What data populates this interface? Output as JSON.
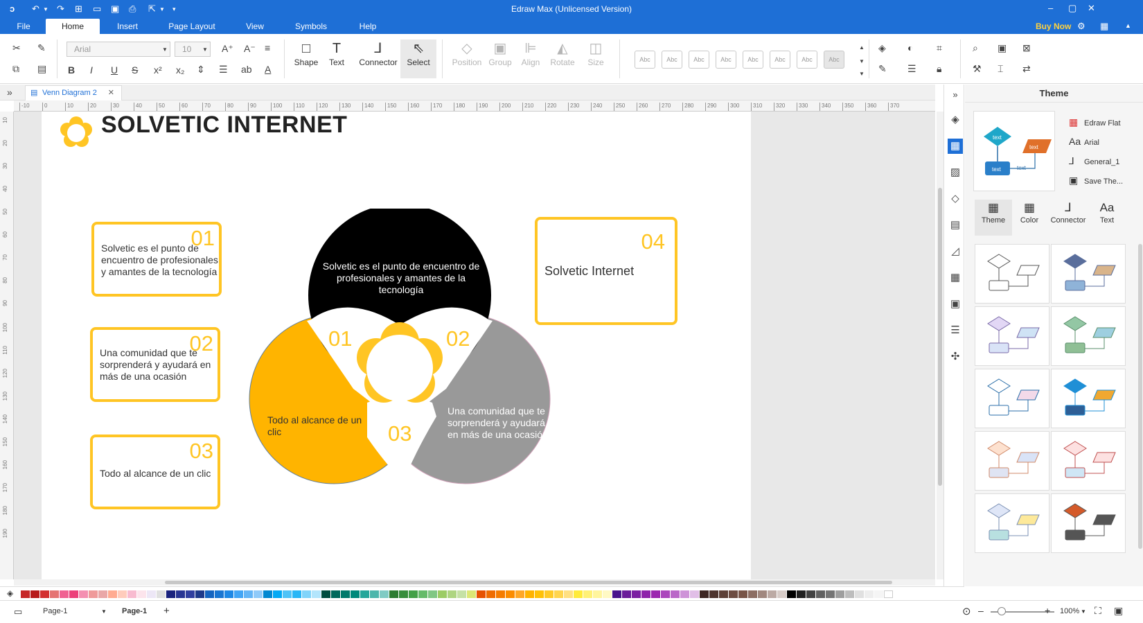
{
  "app": {
    "title": "Edraw Max (Unlicensed Version)",
    "buy_now": "Buy Now"
  },
  "menu": {
    "tabs": [
      {
        "label": "File"
      },
      {
        "label": "Home"
      },
      {
        "label": "Insert"
      },
      {
        "label": "Page Layout"
      },
      {
        "label": "View"
      },
      {
        "label": "Symbols"
      },
      {
        "label": "Help"
      }
    ],
    "active": "Home"
  },
  "ribbon": {
    "font_name": "Arial",
    "font_size": "10",
    "tools": {
      "shape": "Shape",
      "text": "Text",
      "connector": "Connector",
      "select": "Select"
    },
    "arrange": {
      "position": "Position",
      "group": "Group",
      "align": "Align",
      "rotate": "Rotate",
      "size": "Size"
    },
    "style_preset_label": "Abc"
  },
  "document_tab": {
    "label": "Venn Diagram 2"
  },
  "ruler": {
    "h_ticks": [
      "-10",
      "0",
      "10",
      "20",
      "30",
      "40",
      "50",
      "60",
      "70",
      "80",
      "90",
      "100",
      "110",
      "120",
      "130",
      "140",
      "150",
      "160",
      "170",
      "180",
      "190",
      "200",
      "210",
      "220",
      "230",
      "240",
      "250",
      "260",
      "270",
      "280",
      "290",
      "300",
      "310",
      "320",
      "330",
      "340",
      "350",
      "360",
      "370"
    ],
    "v_ticks": [
      "10",
      "20",
      "30",
      "40",
      "50",
      "60",
      "70",
      "80",
      "90",
      "100",
      "110",
      "120",
      "130",
      "140",
      "150",
      "160",
      "170",
      "180",
      "190"
    ]
  },
  "diagram": {
    "title": "SOLVETIC INTERNET",
    "boxes": [
      {
        "num": "01",
        "text": "Solvetic es el punto de encuentro de profesionales y amantes de la tecnología"
      },
      {
        "num": "02",
        "text": "Una comunidad que te sorprenderá y ayudará en más de una ocasión"
      },
      {
        "num": "03",
        "text": "Todo al alcance de un clic"
      },
      {
        "num": "04",
        "text": "Solvetic Internet"
      }
    ],
    "circles": {
      "top_text": "Solvetic es el punto de encuentro de profesionales y amantes de la tecnología",
      "left_text": "Todo al alcance de un clic",
      "right_text": "Una comunidad que te sorprenderá y ayudará en más de una ocasión",
      "n1": "01",
      "n2": "02",
      "n3": "03"
    },
    "colors": {
      "accent": "#FFC524",
      "circle_top": "#000000",
      "circle_left": "#FFB400",
      "circle_right": "#999999"
    }
  },
  "side_panel": {
    "title": "Theme",
    "options": [
      {
        "icon": "color-grid-icon",
        "label": "Edraw Flat"
      },
      {
        "icon": "font-icon",
        "label": "Arial"
      },
      {
        "icon": "connector-icon",
        "label": "General_1"
      },
      {
        "icon": "save-icon",
        "label": "Save The..."
      }
    ],
    "tabs": [
      {
        "label": "Theme"
      },
      {
        "label": "Color"
      },
      {
        "label": "Connector"
      },
      {
        "label": "Text"
      }
    ],
    "preview_text": "text"
  },
  "theme_cards": [
    {
      "diamond": "#ffffff",
      "stroke": "#555555",
      "para": "#ffffff",
      "box": "#ffffff"
    },
    {
      "diamond": "#5a6e9c",
      "stroke": "#5a6e9c",
      "para": "#d9b48a",
      "box": "#8fb3d8"
    },
    {
      "diamond": "#e2d7f5",
      "stroke": "#7a6aa8",
      "para": "#cfe3f5",
      "box": "#d9e3f7"
    },
    {
      "diamond": "#93c7a4",
      "stroke": "#5a8f6b",
      "para": "#9ecfe0",
      "box": "#8fbf95"
    },
    {
      "diamond": "#ffffff",
      "stroke": "#2a6ea8",
      "para": "#f3d9e9",
      "box": "#ffffff"
    },
    {
      "diamond": "#1f8fd6",
      "stroke": "#1f8fd6",
      "para": "#f0a830",
      "box": "#2e5f96"
    },
    {
      "diamond": "#fde1cf",
      "stroke": "#d08a6a",
      "para": "#d9e3f7",
      "box": "#dfe4f3"
    },
    {
      "diamond": "#fde1e1",
      "stroke": "#c05050",
      "para": "#fde1e1",
      "box": "#cfe6f5"
    },
    {
      "diamond": "#dfe6f7",
      "stroke": "#7a8fb3",
      "para": "#fde99a",
      "box": "#b8e0e0"
    },
    {
      "diamond": "#d45a2a",
      "stroke": "#555555",
      "para": "#555555",
      "box": "#555555"
    }
  ],
  "palette": [
    "#c62828",
    "#b71c1c",
    "#d32f2f",
    "#e57373",
    "#f06292",
    "#ec407a",
    "#f48fb1",
    "#ef9a9a",
    "#e9a7a7",
    "#ffab91",
    "#ffccbc",
    "#f8bbd0",
    "#fce4ec",
    "#ede7f6",
    "#e0e0e0",
    "#1a237e",
    "#283593",
    "#303f9f",
    "#1e3a8a",
    "#1565c0",
    "#1976d2",
    "#1e88e5",
    "#42a5f5",
    "#64b5f6",
    "#90caf9",
    "#0288d1",
    "#03a9f4",
    "#4fc3f7",
    "#29b6f6",
    "#81d4fa",
    "#b3e5fc",
    "#004d40",
    "#00695c",
    "#00796b",
    "#00897b",
    "#26a69a",
    "#4db6ac",
    "#80cbc4",
    "#2e7d32",
    "#388e3c",
    "#43a047",
    "#66bb6a",
    "#81c784",
    "#9ccc65",
    "#aed581",
    "#c5e1a5",
    "#dce775",
    "#e65100",
    "#ef6c00",
    "#f57c00",
    "#fb8c00",
    "#ffa726",
    "#ffb300",
    "#ffc107",
    "#ffca28",
    "#ffd54f",
    "#ffe082",
    "#ffeb3b",
    "#fff176",
    "#fff59d",
    "#fff9c4",
    "#4a148c",
    "#6a1b9a",
    "#7b1fa2",
    "#8e24aa",
    "#9c27b0",
    "#ab47bc",
    "#ba68c8",
    "#ce93d8",
    "#e1bee7",
    "#3e2723",
    "#4e342e",
    "#5d4037",
    "#6d4c41",
    "#795548",
    "#8d6e63",
    "#a1887f",
    "#bcaaa4",
    "#d7ccc8",
    "#000000",
    "#212121",
    "#424242",
    "#616161",
    "#757575",
    "#9e9e9e",
    "#bdbdbd",
    "#e0e0e0",
    "#eeeeee",
    "#f5f5f5",
    "#ffffff"
  ],
  "status": {
    "page_select": "Page-1",
    "page_tab": "Page-1",
    "zoom": "100%"
  }
}
